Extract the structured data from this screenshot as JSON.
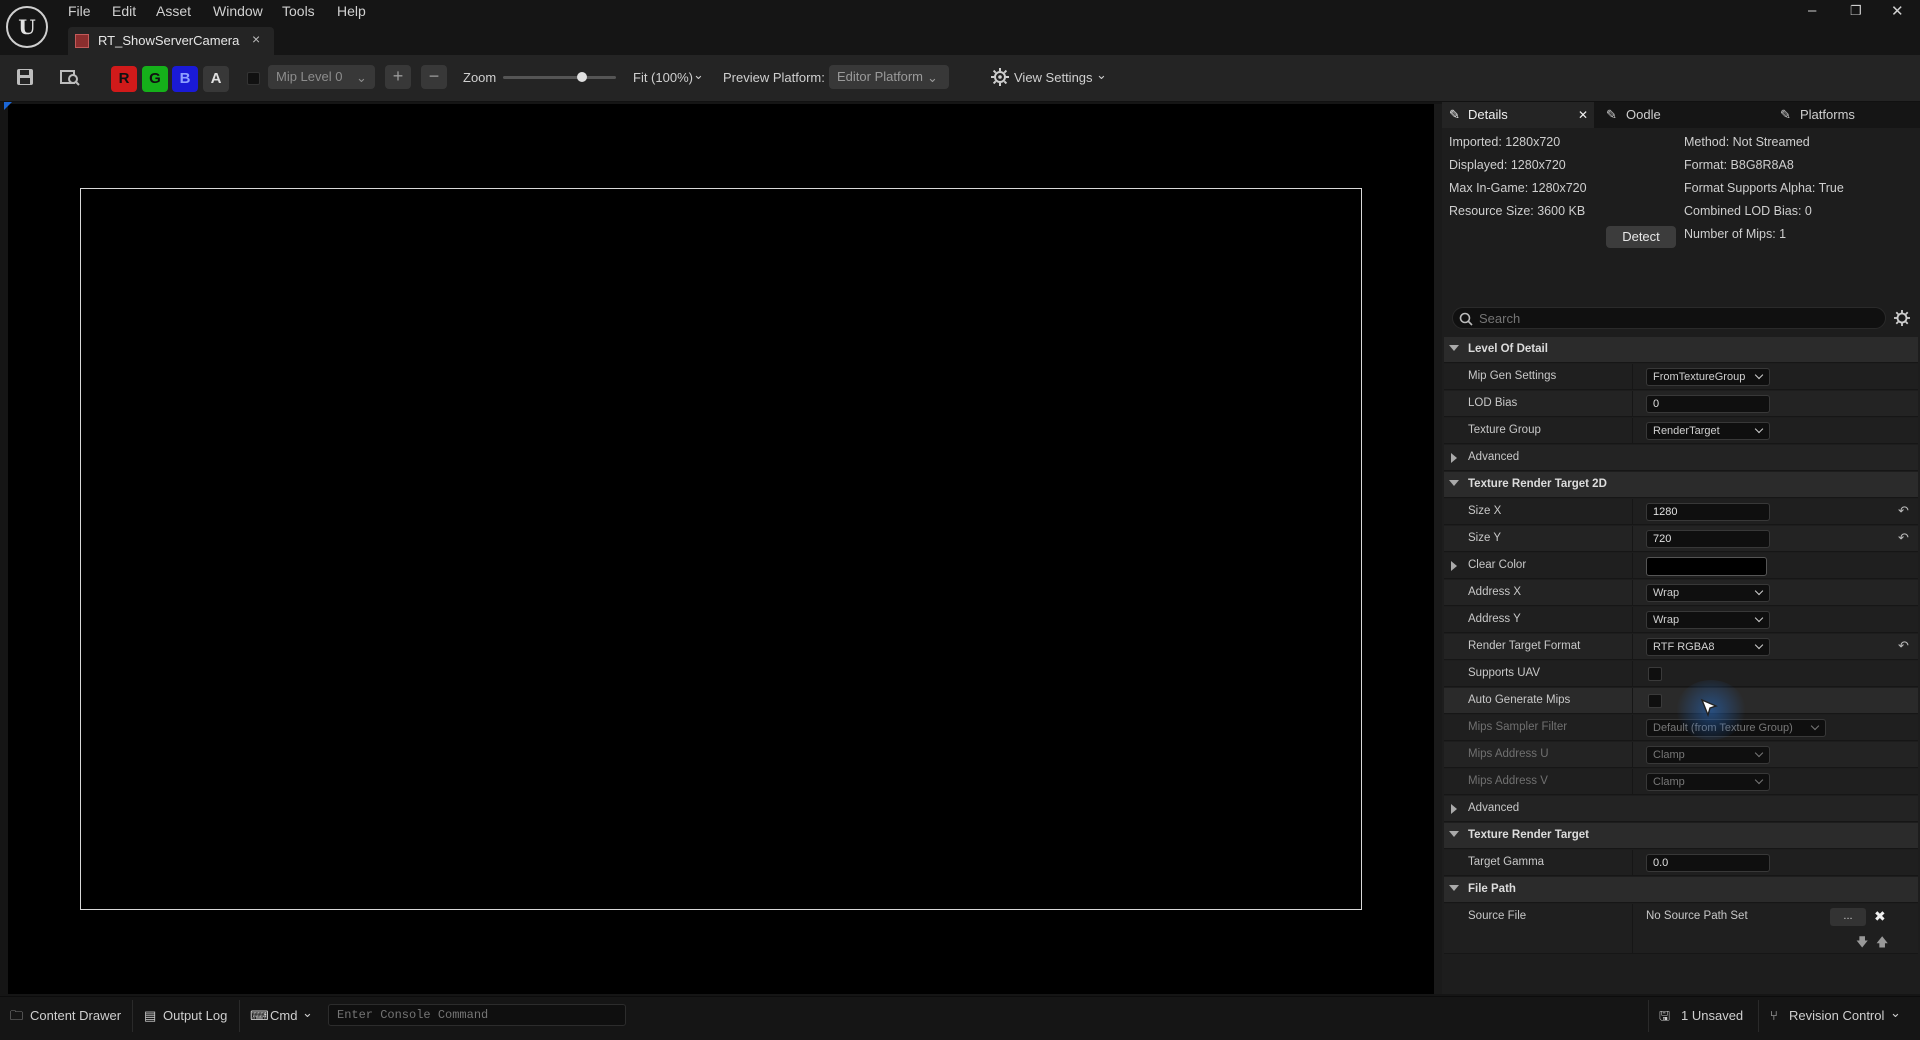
{
  "menu": [
    "File",
    "Edit",
    "Asset",
    "Window",
    "Tools",
    "Help"
  ],
  "document_tab": {
    "title": "RT_ShowServerCamera",
    "close": "×"
  },
  "window_controls": {
    "minimize": "–",
    "restore": "❐",
    "close": "✕"
  },
  "toolbar": {
    "channels": {
      "r": "R",
      "g": "G",
      "b": "B",
      "a": "A",
      "r_color": "#d11a1a",
      "g_color": "#15b01a",
      "b_color": "#1a1ad6"
    },
    "mip_level": "Mip Level 0",
    "zoom_label": "Zoom",
    "zoom_slider_value": 0.7,
    "fit_label": "Fit (100%)",
    "preview_platform_label": "Preview Platform:",
    "preview_platform_value": "Editor Platform",
    "view_settings": "View Settings"
  },
  "panel_tabs": {
    "details": "Details",
    "oodle": "Oodle",
    "platforms": "Platforms"
  },
  "info": {
    "imported": "Imported: 1280x720",
    "displayed": "Displayed: 1280x720",
    "max_in_game": "Max In-Game: 1280x720",
    "resource_size": "Resource Size: 3600 KB",
    "method": "Method: Not Streamed",
    "format": "Format: B8G8R8A8",
    "format_alpha": "Format Supports Alpha: True",
    "lod_bias": "Combined LOD Bias: 0",
    "num_mips": "Number of Mips: 1",
    "detect_button": "Detect"
  },
  "search": {
    "placeholder": "Search"
  },
  "sections": {
    "lod": "Level Of Detail",
    "trt2d": "Texture Render Target 2D",
    "trt": "Texture Render Target",
    "file_path": "File Path"
  },
  "props": {
    "mip_gen_settings": {
      "label": "Mip Gen Settings",
      "value": "FromTextureGroup"
    },
    "lod_bias": {
      "label": "LOD Bias",
      "value": "0"
    },
    "texture_group": {
      "label": "Texture Group",
      "value": "RenderTarget"
    },
    "advanced_1": {
      "label": "Advanced"
    },
    "size_x": {
      "label": "Size X",
      "value": "1280"
    },
    "size_y": {
      "label": "Size Y",
      "value": "720"
    },
    "clear_color": {
      "label": "Clear Color",
      "value_color": "#000000"
    },
    "address_x": {
      "label": "Address X",
      "value": "Wrap"
    },
    "address_y": {
      "label": "Address Y",
      "value": "Wrap"
    },
    "rt_format": {
      "label": "Render Target Format",
      "value": "RTF RGBA8"
    },
    "supports_uav": {
      "label": "Supports UAV",
      "checked": false
    },
    "auto_mips": {
      "label": "Auto Generate Mips",
      "checked": false
    },
    "mips_filter": {
      "label": "Mips Sampler Filter",
      "value": "Default (from Texture Group)"
    },
    "mips_addr_u": {
      "label": "Mips Address U",
      "value": "Clamp"
    },
    "mips_addr_v": {
      "label": "Mips Address V",
      "value": "Clamp"
    },
    "advanced_2": {
      "label": "Advanced"
    },
    "target_gamma": {
      "label": "Target Gamma",
      "value": "0.0"
    },
    "source_file": {
      "label": "Source File",
      "value": "No Source Path Set",
      "browse": "...",
      "clear": "✖"
    }
  },
  "statusbar": {
    "content_drawer": "Content Drawer",
    "output_log": "Output Log",
    "cmd": "Cmd",
    "console_placeholder": "Enter Console Command",
    "unsaved": "1 Unsaved",
    "revision_control": "Revision Control"
  }
}
